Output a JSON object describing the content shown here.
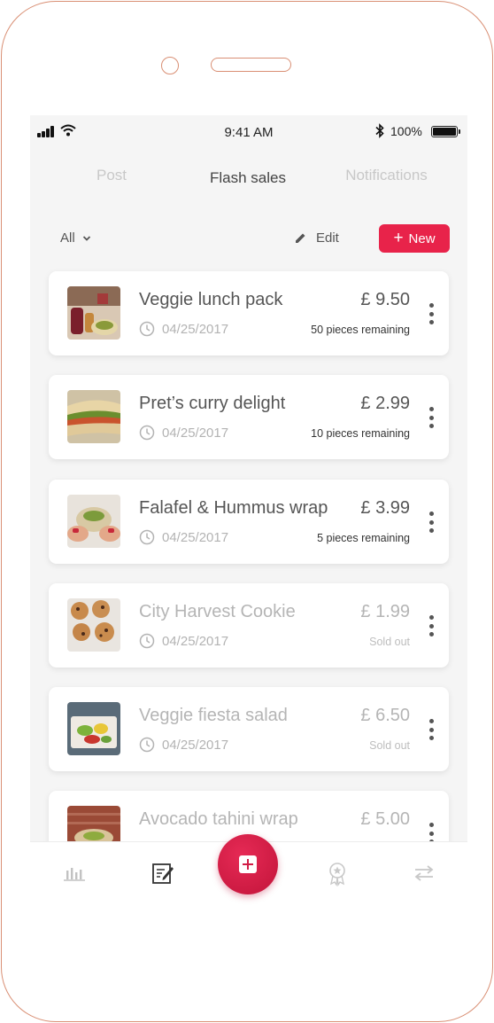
{
  "status_bar": {
    "time": "9:41 AM",
    "battery": "100%",
    "icons": [
      "signal-icon",
      "wifi-icon",
      "bluetooth-icon",
      "battery-icon"
    ]
  },
  "tabs": [
    {
      "label": "Post",
      "active": false
    },
    {
      "label": "Flash sales",
      "active": true
    },
    {
      "label": "Notifications",
      "active": false
    }
  ],
  "toolbar": {
    "filter_label": "All",
    "edit_label": "Edit",
    "new_label": "New"
  },
  "colors": {
    "accent": "#e8234a",
    "frame": "#d98f74",
    "background": "#f5f5f5"
  },
  "items": [
    {
      "name": "Veggie lunch pack",
      "date": "04/25/2017",
      "price": "£ 9.50",
      "stock": "50 pieces remaining",
      "sold_out": false
    },
    {
      "name": "Pret’s curry delight",
      "date": "04/25/2017",
      "price": "£ 2.99",
      "stock": "10 pieces remaining",
      "sold_out": false
    },
    {
      "name": "Falafel & Hummus wrap",
      "date": "04/25/2017",
      "price": "£ 3.99",
      "stock": "5 pieces remaining",
      "sold_out": false
    },
    {
      "name": "City Harvest Cookie",
      "date": "04/25/2017",
      "price": "£ 1.99",
      "stock": "Sold out",
      "sold_out": true
    },
    {
      "name": "Veggie fiesta salad",
      "date": "04/25/2017",
      "price": "£ 6.50",
      "stock": "Sold out",
      "sold_out": true
    },
    {
      "name": "Avocado tahini wrap",
      "date": "",
      "price": "£ 5.00",
      "stock": "",
      "sold_out": true
    }
  ],
  "bottom_nav": [
    "stats-icon",
    "edit-note-icon",
    "add-icon",
    "badge-icon",
    "swap-icon"
  ]
}
